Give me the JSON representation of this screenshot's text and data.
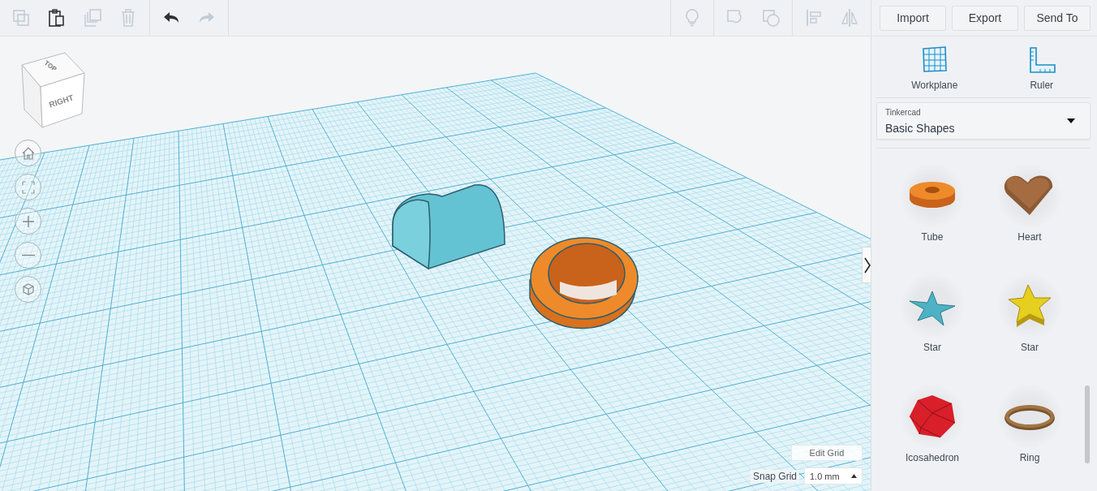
{
  "toolbar": {
    "left_tools": [
      {
        "kind": "copy",
        "disabled": true
      },
      {
        "kind": "paste",
        "disabled": false
      },
      {
        "kind": "duplicate",
        "disabled": true
      },
      {
        "kind": "delete",
        "disabled": true
      }
    ],
    "history_tools": [
      {
        "kind": "undo",
        "disabled": false
      },
      {
        "kind": "redo",
        "disabled": true
      }
    ],
    "right_tools": [
      {
        "kind": "notes",
        "disabled": true
      },
      {
        "kind": "group",
        "disabled": true
      },
      {
        "kind": "ungroup",
        "disabled": true
      },
      {
        "kind": "align",
        "disabled": true
      },
      {
        "kind": "mirror",
        "disabled": true
      }
    ],
    "actions": [
      "Import",
      "Export",
      "Send To"
    ]
  },
  "view_cube": {
    "top": "TOP",
    "right": "RIGHT"
  },
  "view_controls": [
    {
      "kind": "home"
    },
    {
      "kind": "fit"
    },
    {
      "kind": "zoom_in"
    },
    {
      "kind": "zoom_out"
    },
    {
      "kind": "perspective"
    }
  ],
  "scene": {
    "objects": [
      {
        "kind": "roof"
      },
      {
        "kind": "tube"
      }
    ]
  },
  "grid": {
    "edit_label": "Edit Grid",
    "snap_label": "Snap Grid",
    "snap_value": "1.0 mm"
  },
  "panel": {
    "tools": [
      {
        "kind": "workplane",
        "label": "Workplane"
      },
      {
        "kind": "ruler",
        "label": "Ruler"
      }
    ],
    "library": {
      "label": "Tinkercad",
      "value": "Basic Shapes"
    },
    "shapes": [
      {
        "kind": "tube",
        "label": "Tube"
      },
      {
        "kind": "heart",
        "label": "Heart"
      },
      {
        "kind": "star_teal",
        "label": "Star"
      },
      {
        "kind": "star_gold",
        "label": "Star"
      },
      {
        "kind": "icosahedron",
        "label": "Icosahedron"
      },
      {
        "kind": "ring",
        "label": "Ring"
      }
    ]
  }
}
